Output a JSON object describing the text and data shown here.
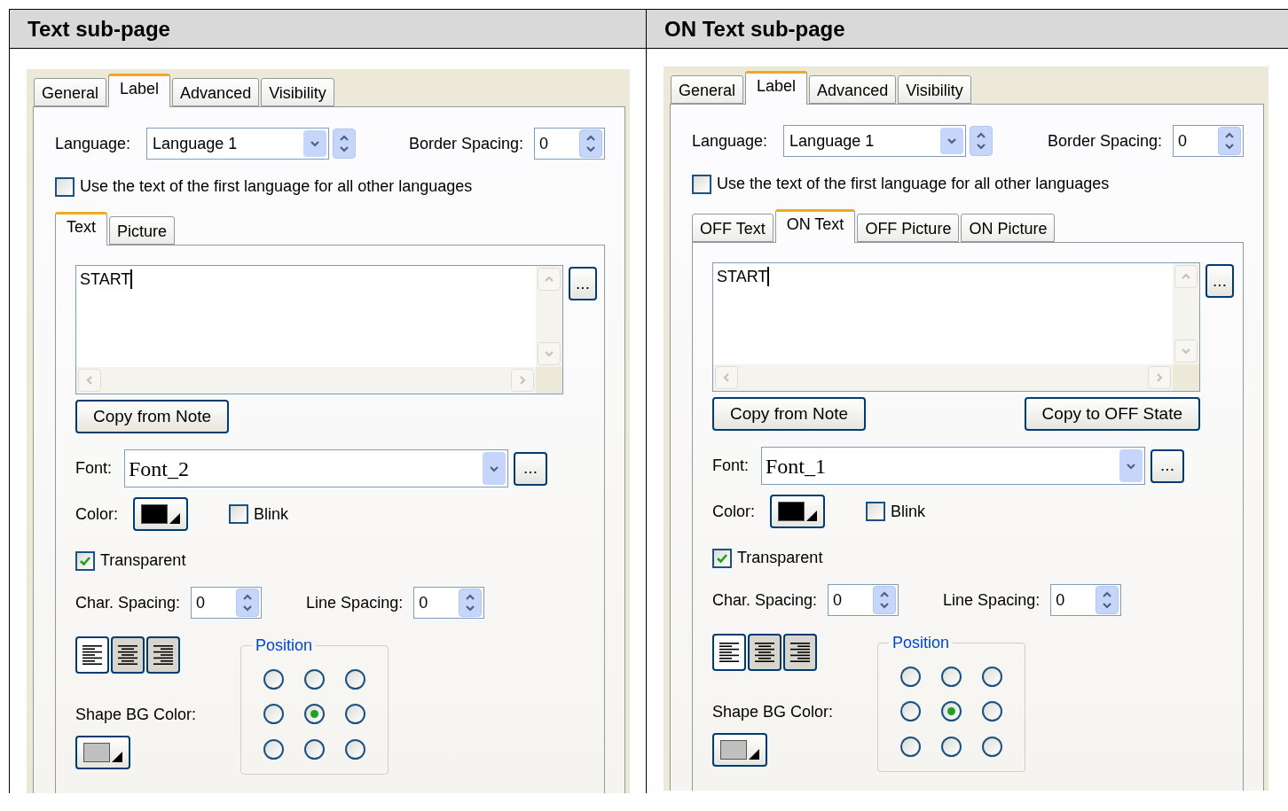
{
  "columns": [
    {
      "heading": "Text sub-page",
      "dialog": {
        "tabs": [
          {
            "label": "General",
            "selected": false
          },
          {
            "label": "Label",
            "selected": true
          },
          {
            "label": "Advanced",
            "selected": false
          },
          {
            "label": "Visibility",
            "selected": false
          }
        ],
        "language": {
          "label": "Language:",
          "value": "Language 1"
        },
        "border_spacing": {
          "label": "Border Spacing:",
          "value": "0"
        },
        "use_first_language": {
          "label": "Use the text of the first language for all other languages",
          "checked": false
        },
        "sub_tabs": [
          {
            "label": "Text",
            "selected": true
          },
          {
            "label": "Picture",
            "selected": false
          }
        ],
        "text_value": "START",
        "more_button": "...",
        "buttons": [
          {
            "label": "Copy from Note"
          }
        ],
        "font": {
          "label": "Font:",
          "value": "Font_2"
        },
        "font_more_button": "...",
        "color": {
          "label": "Color:",
          "color": "#000000"
        },
        "blink": {
          "label": "Blink",
          "checked": false
        },
        "transparent": {
          "label": "Transparent",
          "checked": true
        },
        "char_spacing": {
          "label": "Char. Spacing:",
          "value": "0"
        },
        "line_spacing": {
          "label": "Line Spacing:",
          "value": "0"
        },
        "alignments": [
          {
            "kind": "left",
            "selected": true
          },
          {
            "kind": "center",
            "selected": false
          },
          {
            "kind": "right",
            "selected": false
          }
        ],
        "position": {
          "title": "Position",
          "options": [
            {
              "selected": false
            },
            {
              "selected": false
            },
            {
              "selected": false
            },
            {
              "selected": false
            },
            {
              "selected": true
            },
            {
              "selected": false
            },
            {
              "selected": false
            },
            {
              "selected": false
            },
            {
              "selected": false
            }
          ]
        },
        "shape_bg_color": {
          "label": "Shape BG Color:",
          "color": "#c0c0c0"
        }
      }
    },
    {
      "heading": "ON Text sub-page",
      "dialog": {
        "tabs": [
          {
            "label": "General",
            "selected": false
          },
          {
            "label": "Label",
            "selected": true
          },
          {
            "label": "Advanced",
            "selected": false
          },
          {
            "label": "Visibility",
            "selected": false
          }
        ],
        "language": {
          "label": "Language:",
          "value": "Language 1"
        },
        "border_spacing": {
          "label": "Border Spacing:",
          "value": "0"
        },
        "use_first_language": {
          "label": "Use the text of the first language for all other languages",
          "checked": false
        },
        "sub_tabs": [
          {
            "label": "OFF Text",
            "selected": false
          },
          {
            "label": "ON Text",
            "selected": true
          },
          {
            "label": "OFF Picture",
            "selected": false
          },
          {
            "label": "ON Picture",
            "selected": false
          }
        ],
        "text_value": "START",
        "more_button": "...",
        "buttons": [
          {
            "label": "Copy from Note"
          },
          {
            "label": "Copy to OFF State"
          }
        ],
        "font": {
          "label": "Font:",
          "value": "Font_1"
        },
        "font_more_button": "...",
        "color": {
          "label": "Color:",
          "color": "#000000"
        },
        "blink": {
          "label": "Blink",
          "checked": false
        },
        "transparent": {
          "label": "Transparent",
          "checked": true
        },
        "char_spacing": {
          "label": "Char. Spacing:",
          "value": "0"
        },
        "line_spacing": {
          "label": "Line Spacing:",
          "value": "0"
        },
        "alignments": [
          {
            "kind": "left",
            "selected": true
          },
          {
            "kind": "center",
            "selected": false
          },
          {
            "kind": "right",
            "selected": false
          }
        ],
        "position": {
          "title": "Position",
          "options": [
            {
              "selected": false
            },
            {
              "selected": false
            },
            {
              "selected": false
            },
            {
              "selected": false
            },
            {
              "selected": true
            },
            {
              "selected": false
            },
            {
              "selected": false
            },
            {
              "selected": false
            },
            {
              "selected": false
            }
          ]
        },
        "shape_bg_color": {
          "label": "Shape BG Color:",
          "color": "#c0c0c0"
        }
      }
    }
  ]
}
